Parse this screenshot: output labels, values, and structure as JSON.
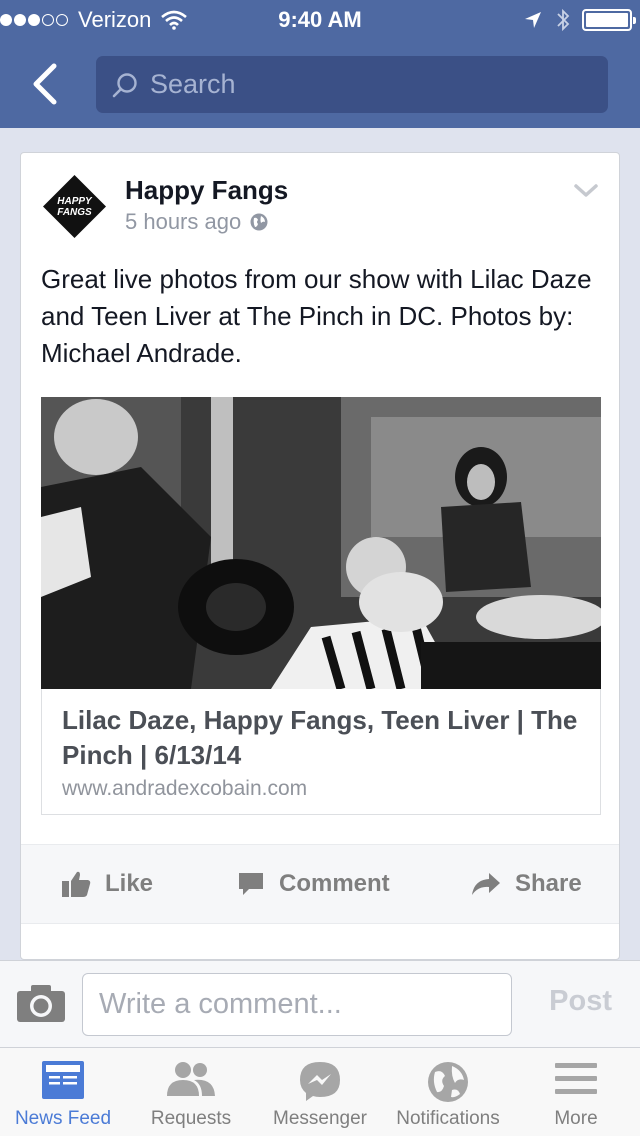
{
  "status_bar": {
    "carrier": "Verizon",
    "time": "9:40 AM",
    "signal_filled": 3,
    "signal_total": 5
  },
  "search": {
    "placeholder": "Search"
  },
  "post": {
    "author": "Happy Fangs",
    "avatar_text": "HAPPY FANGS",
    "timestamp": "5 hours ago",
    "text": "Great live photos from our show with Lilac Daze and Teen Liver at The Pinch in DC. Photos by: Michael Andrade.",
    "link": {
      "title": "Lilac Daze, Happy Fangs, Teen Liver | The Pinch | 6/13/14",
      "url": "www.andradexcobain.com"
    },
    "actions": {
      "like": "Like",
      "comment": "Comment",
      "share": "Share"
    }
  },
  "comment_bar": {
    "placeholder": "Write a comment...",
    "post_label": "Post"
  },
  "tab_bar": {
    "items": [
      {
        "label": "News Feed",
        "icon": "news-feed-icon",
        "active": true
      },
      {
        "label": "Requests",
        "icon": "friends-icon",
        "active": false
      },
      {
        "label": "Messenger",
        "icon": "messenger-icon",
        "active": false
      },
      {
        "label": "Notifications",
        "icon": "globe-icon",
        "active": false
      },
      {
        "label": "More",
        "icon": "menu-icon",
        "active": false
      }
    ]
  },
  "colors": {
    "brand": "#4e69a2",
    "active_tab": "#4b7bd6",
    "background": "#dfe3ee"
  }
}
